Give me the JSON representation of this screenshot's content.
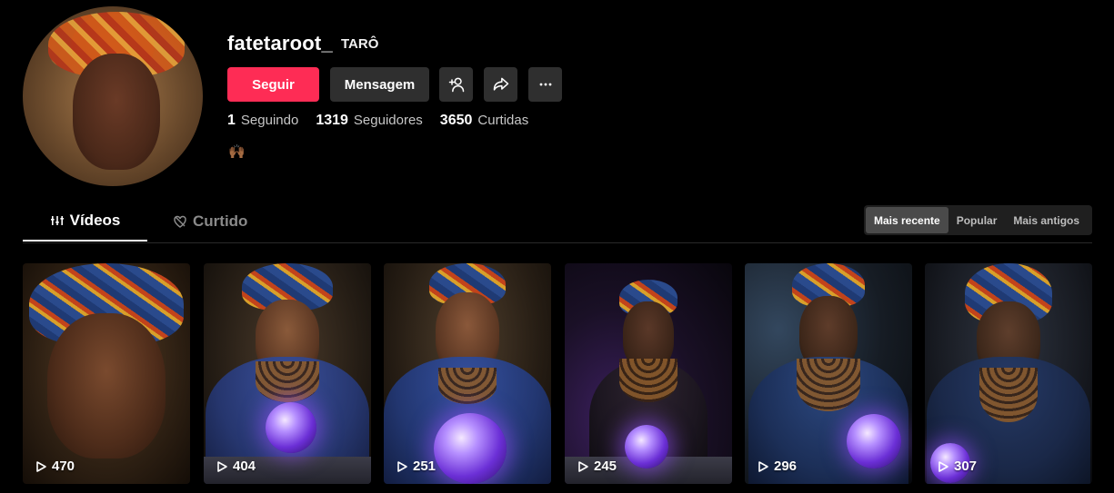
{
  "profile": {
    "username": "fatetaroot_",
    "nickname": "TARÔ",
    "bio": "🙌🏾",
    "avatar_icon": "profile-avatar"
  },
  "actions": {
    "follow_label": "Seguir",
    "message_label": "Mensagem",
    "add_friend_icon": "add-friend-icon",
    "share_icon": "share-icon",
    "more_icon": "more-icon"
  },
  "stats": [
    {
      "value": "1",
      "label": "Seguindo"
    },
    {
      "value": "1319",
      "label": "Seguidores"
    },
    {
      "value": "3650",
      "label": "Curtidas"
    }
  ],
  "tabs": [
    {
      "label": "Vídeos",
      "icon": "videos-icon",
      "active": true
    },
    {
      "label": "Curtido",
      "icon": "liked-icon",
      "active": false
    }
  ],
  "sort": [
    {
      "label": "Mais recente",
      "active": true
    },
    {
      "label": "Popular",
      "active": false
    },
    {
      "label": "Mais antigos",
      "active": false
    }
  ],
  "videos": [
    {
      "views": "470"
    },
    {
      "views": "404"
    },
    {
      "views": "251"
    },
    {
      "views": "245"
    },
    {
      "views": "296"
    },
    {
      "views": "307"
    }
  ],
  "colors": {
    "accent": "#fe2c55",
    "background": "#000000",
    "button_dark": "#2f2f2f"
  }
}
